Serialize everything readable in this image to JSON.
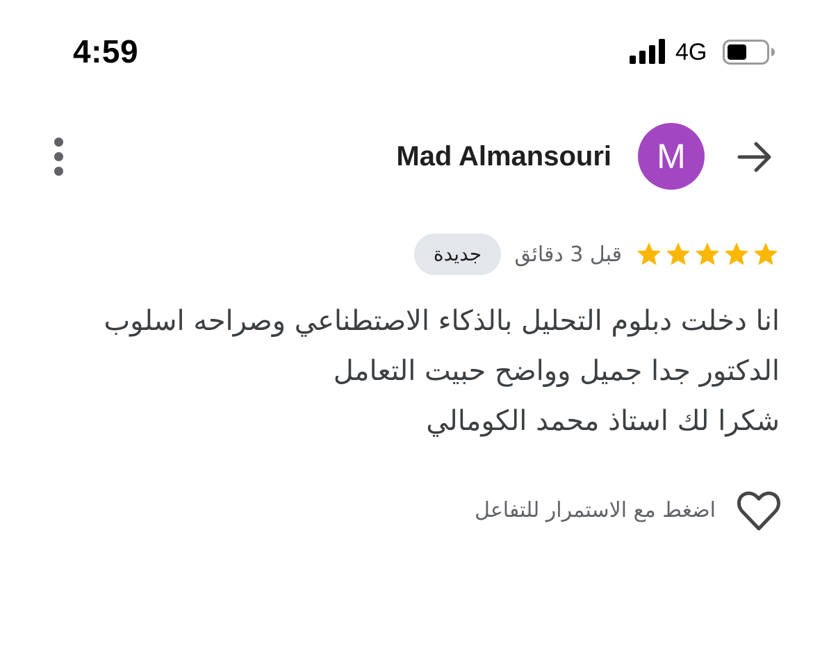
{
  "status_bar": {
    "time": "4:59",
    "network": "4G",
    "signal_bars_filled": 4,
    "battery_level": 0.5
  },
  "header": {
    "author_name": "Mad Almansouri",
    "avatar_initial": "M",
    "avatar_color": "#a346c2",
    "menu_icon": "more-vertical-icon",
    "forward_icon": "arrow-right-icon"
  },
  "rating": {
    "stars": 5,
    "max_stars": 5,
    "star_color": "#f9b707",
    "time_ago": "قبل 3 دقائق",
    "badge": "جديدة"
  },
  "review": {
    "lines": [
      "انا دخلت دبلوم التحليل بالذكاء الاصتطناعي وصراحه اسلوب",
      "الدكتور جدا جميل وواضح حبيت التعامل",
      "شكرا لك استاذ محمد الكومالي"
    ]
  },
  "like": {
    "icon": "heart-outline-icon",
    "hint": "اضغط مع الاستمرار للتفاعل"
  }
}
